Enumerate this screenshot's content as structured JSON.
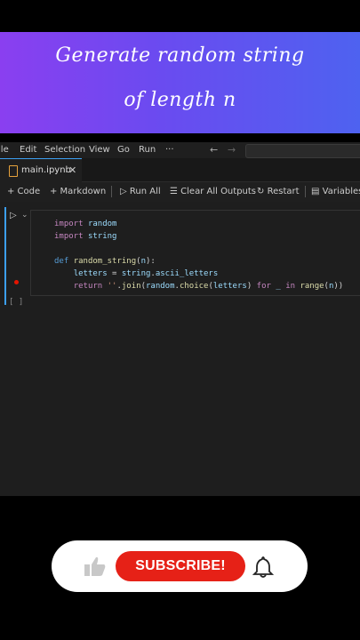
{
  "banner": {
    "line1": "Generate random string",
    "line2": "of length n"
  },
  "menu": [
    "File",
    "Edit",
    "Selection",
    "View",
    "Go",
    "Run",
    "···"
  ],
  "tab": {
    "label": "main.ipynb",
    "close": "✕"
  },
  "toolbar": {
    "code": "+ Code",
    "markdown": "+ Markdown",
    "run_all": "Run All",
    "clear_outputs": "Clear All Outputs",
    "restart": "Restart",
    "variables": "Variables"
  },
  "code": [
    "import random",
    "import string",
    "",
    "def random_string(n):",
    "    letters = string.ascii_letters",
    "    return ''.join(random.choice(letters) for _ in range(n))"
  ],
  "empty_cell_marker": "[ ]",
  "subscribe": {
    "label": "SUBSCRIBE!"
  },
  "colors": {
    "accent": "#3c9ff2",
    "subscribe": "#e62117",
    "banner_start": "#8a3ff0",
    "banner_end": "#4e62f0"
  }
}
